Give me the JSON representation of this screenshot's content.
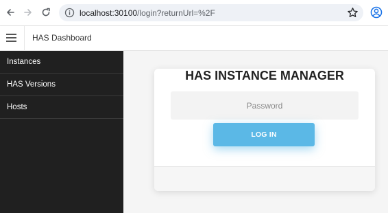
{
  "browser": {
    "url_host": "localhost:30100",
    "url_path": "/login?returnUrl=%2F"
  },
  "header": {
    "title": "HAS Dashboard"
  },
  "sidebar": {
    "items": [
      {
        "label": "Instances"
      },
      {
        "label": "HAS Versions"
      },
      {
        "label": "Hosts"
      }
    ]
  },
  "login": {
    "title": "HAS INSTANCE MANAGER",
    "password_placeholder": "Password",
    "password_value": "",
    "button_label": "LOG IN"
  },
  "icons": {
    "back": "arrow-left-icon",
    "forward": "arrow-right-icon",
    "reload": "reload-icon",
    "info": "info-icon",
    "bookmark": "star-icon",
    "profile": "profile-icon",
    "menu": "hamburger-icon"
  },
  "colors": {
    "sidebar_bg": "#202020",
    "button_bg": "#5bb8e6",
    "omnibox_bg": "#eef1f6",
    "profile_accent": "#1a73e8"
  }
}
